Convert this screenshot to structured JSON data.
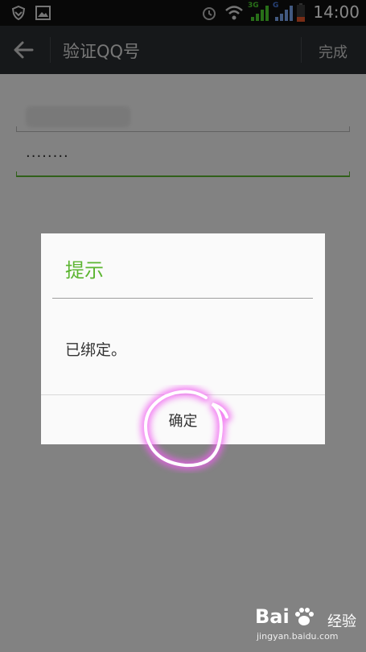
{
  "status_bar": {
    "time": "14:00",
    "network_labels": [
      "3G",
      "G"
    ],
    "icons": [
      "shield-icon",
      "image-icon",
      "alarm-icon",
      "wifi-icon",
      "signal-icon",
      "signal-icon",
      "battery-icon"
    ]
  },
  "action_bar": {
    "back_icon": "arrow-left-icon",
    "title": "验证QQ号",
    "done_label": "完成"
  },
  "form": {
    "password_value": "········"
  },
  "dialog": {
    "title": "提示",
    "message": "已绑定。",
    "confirm_label": "确定"
  },
  "watermark": {
    "brand": "Bai",
    "brand_suffix": "经验",
    "url": "jingyan.baidu.com"
  },
  "colors": {
    "accent_green": "#5cb531",
    "overlay": "rgba(0,0,0,0.47)",
    "annotation_magenta": "#e040e0"
  }
}
